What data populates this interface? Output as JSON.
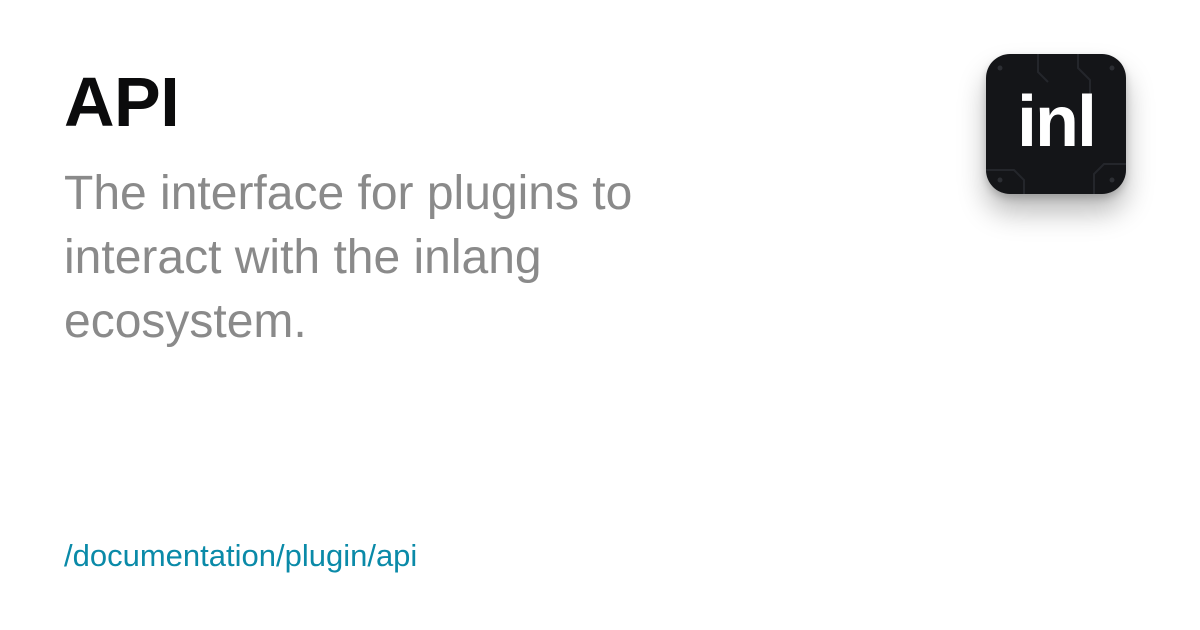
{
  "header": {
    "title": "API",
    "subtitle": "The interface for plugins to interact with the inlang ecosystem."
  },
  "logo": {
    "text": "inl",
    "icon": "inlang-logo-icon",
    "background_color": "#141518"
  },
  "footer": {
    "path": "/documentation/plugin/api",
    "link_color": "#0a8aa8"
  }
}
